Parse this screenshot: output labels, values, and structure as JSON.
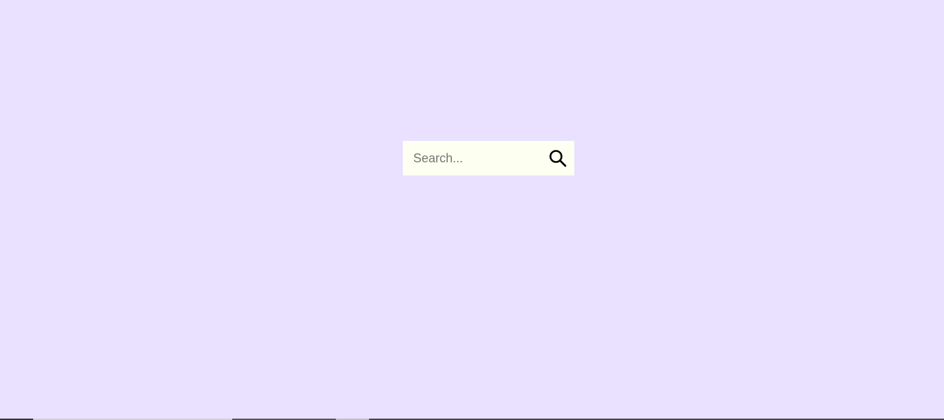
{
  "search": {
    "placeholder": "Search...",
    "value": "",
    "icon": "search-icon"
  },
  "colors": {
    "background": "#e9e1ff",
    "search_box": "#fdfff0",
    "icon": "#000000"
  }
}
